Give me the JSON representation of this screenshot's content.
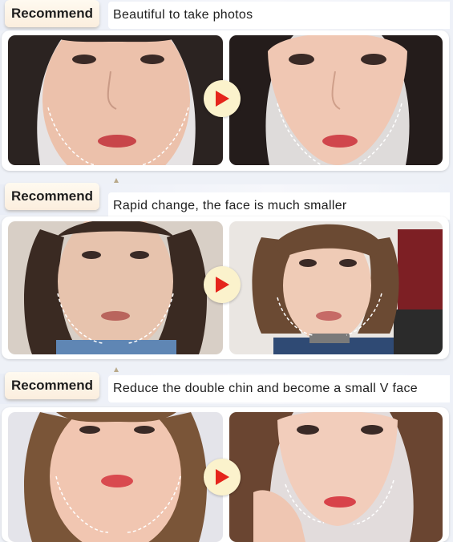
{
  "sections": [
    {
      "tag": "Recommend",
      "caption": "Beautiful to take photos"
    },
    {
      "tag": "Recommend",
      "caption": "Rapid change, the face is much smaller"
    },
    {
      "tag": "Recommend",
      "caption": "Reduce the double chin and become a small V face"
    }
  ],
  "colors": {
    "arrow": "#e5241b",
    "arrow_bg": "#fbf2cc",
    "tag_bg": "#fbeede"
  },
  "icons": {
    "arrow": "play-arrow-icon"
  }
}
